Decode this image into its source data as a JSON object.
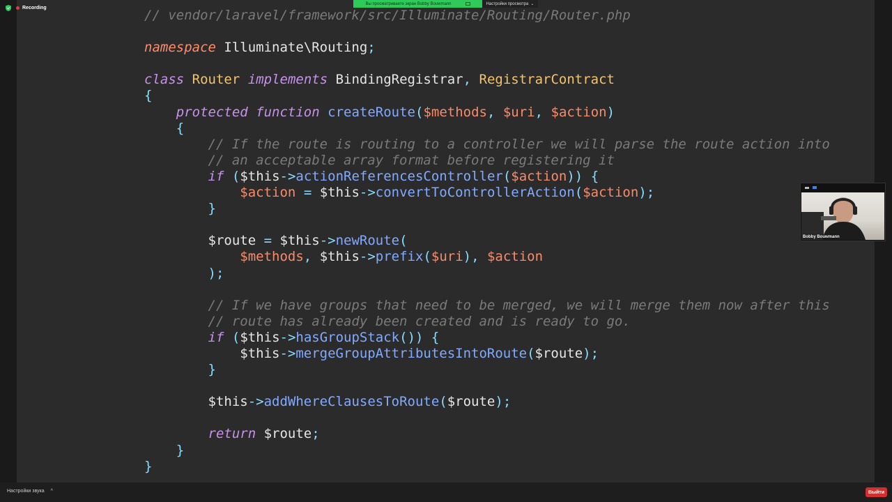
{
  "recording": {
    "label": "Recording"
  },
  "share_bar": {
    "text": "Вы просматриваете экран Bobby Bouwmann"
  },
  "view_options": {
    "label": "Настройки просмотра",
    "caret": "⌄"
  },
  "video": {
    "participant_name": "Bobby Bouwmann"
  },
  "bottom_bar": {
    "sound_settings_label": "Настройки звука",
    "caret": "^"
  },
  "exit_button": {
    "label": "Выйти"
  },
  "colors": {
    "editor_bg": "#2b2b2b",
    "comment": "#7a7a7a",
    "keyword": "#c792ea",
    "namespace_keyword": "#ff8c6b",
    "class_name": "#f3c46b",
    "function": "#82aaff",
    "variable": "#f78c6c",
    "punctuation": "#89ddff",
    "share_bar": "#2fcb5a",
    "exit": "#d32f2f"
  },
  "code_lines": [
    [
      [
        "c",
        "// vendor/laravel/framework/src/Illuminate/Routing/Router.php"
      ]
    ],
    [],
    [
      [
        "ns",
        "namespace"
      ],
      [
        "t",
        " Illuminate\\Routing"
      ],
      [
        "p",
        ";"
      ]
    ],
    [],
    [
      [
        "k",
        "class"
      ],
      [
        "t",
        " "
      ],
      [
        "cls",
        "Router"
      ],
      [
        "t",
        " "
      ],
      [
        "k",
        "implements"
      ],
      [
        "t",
        " BindingRegistrar"
      ],
      [
        "p",
        ","
      ],
      [
        "t",
        " "
      ],
      [
        "cls",
        "RegistrarContract"
      ]
    ],
    [
      [
        "p",
        "{"
      ]
    ],
    [
      [
        "t",
        "    "
      ],
      [
        "k",
        "protected"
      ],
      [
        "t",
        " "
      ],
      [
        "k",
        "function"
      ],
      [
        "t",
        " "
      ],
      [
        "fn",
        "createRoute"
      ],
      [
        "p",
        "("
      ],
      [
        "v",
        "$methods"
      ],
      [
        "p",
        ","
      ],
      [
        "t",
        " "
      ],
      [
        "v",
        "$uri"
      ],
      [
        "p",
        ","
      ],
      [
        "t",
        " "
      ],
      [
        "v",
        "$action"
      ],
      [
        "p",
        ")"
      ]
    ],
    [
      [
        "t",
        "    "
      ],
      [
        "p",
        "{"
      ]
    ],
    [
      [
        "t",
        "        "
      ],
      [
        "c",
        "// If the route is routing to a controller we will parse the route action into"
      ]
    ],
    [
      [
        "t",
        "        "
      ],
      [
        "c",
        "// an acceptable array format before registering it"
      ]
    ],
    [
      [
        "t",
        "        "
      ],
      [
        "k",
        "if"
      ],
      [
        "t",
        " "
      ],
      [
        "p",
        "("
      ],
      [
        "t",
        "$this"
      ],
      [
        "p",
        "->"
      ],
      [
        "fn",
        "actionReferencesController"
      ],
      [
        "p",
        "("
      ],
      [
        "v",
        "$action"
      ],
      [
        "p",
        "))"
      ],
      [
        "t",
        " "
      ],
      [
        "p",
        "{"
      ]
    ],
    [
      [
        "t",
        "            "
      ],
      [
        "v",
        "$action"
      ],
      [
        "t",
        " "
      ],
      [
        "p",
        "="
      ],
      [
        "t",
        " $this"
      ],
      [
        "p",
        "->"
      ],
      [
        "fn",
        "convertToControllerAction"
      ],
      [
        "p",
        "("
      ],
      [
        "v",
        "$action"
      ],
      [
        "p",
        ");"
      ]
    ],
    [
      [
        "t",
        "        "
      ],
      [
        "p",
        "}"
      ]
    ],
    [],
    [
      [
        "t",
        "        $route "
      ],
      [
        "p",
        "="
      ],
      [
        "t",
        " $this"
      ],
      [
        "p",
        "->"
      ],
      [
        "fn",
        "newRoute"
      ],
      [
        "p",
        "("
      ]
    ],
    [
      [
        "t",
        "            "
      ],
      [
        "v",
        "$methods"
      ],
      [
        "p",
        ","
      ],
      [
        "t",
        " $this"
      ],
      [
        "p",
        "->"
      ],
      [
        "fn",
        "prefix"
      ],
      [
        "p",
        "("
      ],
      [
        "v",
        "$uri"
      ],
      [
        "p",
        "),"
      ],
      [
        "t",
        " "
      ],
      [
        "v",
        "$action"
      ]
    ],
    [
      [
        "t",
        "        "
      ],
      [
        "p",
        ");"
      ]
    ],
    [],
    [
      [
        "t",
        "        "
      ],
      [
        "c",
        "// If we have groups that need to be merged, we will merge them now after this"
      ]
    ],
    [
      [
        "t",
        "        "
      ],
      [
        "c",
        "// route has already been created and is ready to go."
      ]
    ],
    [
      [
        "t",
        "        "
      ],
      [
        "k",
        "if"
      ],
      [
        "t",
        " "
      ],
      [
        "p",
        "("
      ],
      [
        "t",
        "$this"
      ],
      [
        "p",
        "->"
      ],
      [
        "fn",
        "hasGroupStack"
      ],
      [
        "p",
        "())"
      ],
      [
        "t",
        " "
      ],
      [
        "p",
        "{"
      ]
    ],
    [
      [
        "t",
        "            $this"
      ],
      [
        "p",
        "->"
      ],
      [
        "fn",
        "mergeGroupAttributesIntoRoute"
      ],
      [
        "p",
        "("
      ],
      [
        "t",
        "$route"
      ],
      [
        "p",
        ");"
      ]
    ],
    [
      [
        "t",
        "        "
      ],
      [
        "p",
        "}"
      ]
    ],
    [],
    [
      [
        "t",
        "        $this"
      ],
      [
        "p",
        "->"
      ],
      [
        "fn",
        "addWhereClausesToRoute"
      ],
      [
        "p",
        "("
      ],
      [
        "t",
        "$route"
      ],
      [
        "p",
        ");"
      ]
    ],
    [],
    [
      [
        "t",
        "        "
      ],
      [
        "k",
        "return"
      ],
      [
        "t",
        " $route"
      ],
      [
        "p",
        ";"
      ]
    ],
    [
      [
        "t",
        "    "
      ],
      [
        "p",
        "}"
      ]
    ],
    [
      [
        "p",
        "}"
      ]
    ]
  ]
}
